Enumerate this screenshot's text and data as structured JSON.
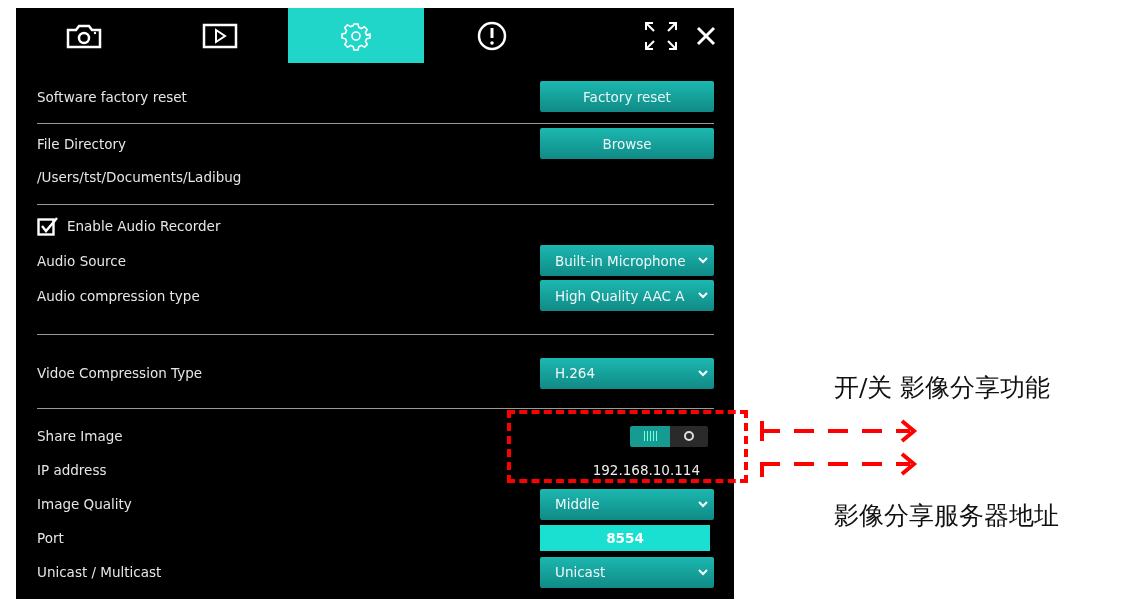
{
  "tabs": [
    {
      "kind": "camera",
      "selected": false
    },
    {
      "kind": "play",
      "selected": false
    },
    {
      "kind": "settings",
      "selected": true
    },
    {
      "kind": "info",
      "selected": false
    }
  ],
  "sections": [
    {
      "rows": [
        {
          "kind": "button",
          "label": "Software factory reset",
          "value": "Factory reset"
        }
      ]
    },
    {
      "rows": [
        {
          "kind": "button",
          "label": "File Directory",
          "value": "Browse"
        },
        {
          "kind": "text",
          "label": "/Users/tst/Documents/Ladibug"
        }
      ]
    },
    {
      "rows": [
        {
          "kind": "checkbox",
          "label": "Enable Audio Recorder",
          "checked": true
        },
        {
          "kind": "dropdown",
          "label": "Audio Source",
          "value": "Built-in Microphone"
        },
        {
          "kind": "dropdown",
          "label": "Audio compression type",
          "value": "High Quality AAC A"
        }
      ]
    },
    {
      "rows": [
        {
          "kind": "dropdown",
          "label": "Vidoe Compression Type",
          "value": "H.264"
        }
      ]
    },
    {
      "rows": [
        {
          "kind": "toggle",
          "label": "Share Image",
          "on": true
        },
        {
          "kind": "value",
          "label": "IP address",
          "value": "192.168.10.114"
        },
        {
          "kind": "dropdown",
          "label": "Image Quality",
          "value": "Middle"
        },
        {
          "kind": "input",
          "label": "Port",
          "value": "8554"
        },
        {
          "kind": "dropdown",
          "label": "Unicast / Multicast",
          "value": "Unicast"
        }
      ]
    }
  ],
  "annotations": [
    {
      "text": "开/关 影像分享功能"
    },
    {
      "text": "影像分享服务器地址"
    }
  ]
}
